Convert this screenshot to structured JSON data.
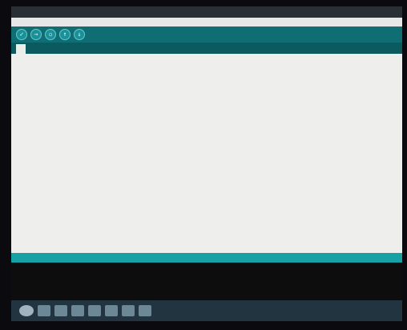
{
  "window": {
    "title": ""
  },
  "menu": {
    "items": [
      "",
      "",
      "",
      "",
      ""
    ]
  },
  "toolbar": {
    "buttons": [
      "verify-icon",
      "upload-icon",
      "new-icon",
      "open-icon",
      "save-icon"
    ]
  },
  "tabs": [
    {
      "label": ""
    }
  ],
  "editor": {
    "lines": [
      {
        "t": "",
        "c": "cm"
      },
      {
        "t": "",
        "c": ""
      },
      {
        "t": "",
        "c": "kw"
      },
      {
        "t": "",
        "c": "kw"
      },
      {
        "t": "",
        "c": ""
      },
      {
        "t": "",
        "c": ""
      },
      {
        "t": "",
        "c": ""
      },
      {
        "t": "",
        "c": ""
      },
      {
        "t": "",
        "c": ""
      },
      {
        "t": "",
        "c": ""
      },
      {
        "t": "",
        "c": ""
      },
      {
        "t": "",
        "c": ""
      },
      {
        "t": "",
        "c": "fn"
      },
      {
        "t": "",
        "c": ""
      },
      {
        "t": "",
        "c": "fn"
      },
      {
        "t": "",
        "c": ""
      },
      {
        "t": "",
        "c": "ind"
      },
      {
        "t": "",
        "c": "ind"
      },
      {
        "t": "",
        "c": "ind"
      },
      {
        "t": "",
        "c": "ind"
      },
      {
        "t": "",
        "c": "ind"
      },
      {
        "t": "",
        "c": "ind"
      },
      {
        "t": "",
        "c": "ind"
      },
      {
        "t": "",
        "c": "ind"
      },
      {
        "t": "",
        "c": "ind"
      }
    ]
  },
  "console": {
    "board": ""
  },
  "taskbar": {
    "clock": ""
  },
  "colors": {
    "toolbar": "#0f6e74",
    "status": "#17a1a5",
    "editor_bg": "#eeefed"
  }
}
